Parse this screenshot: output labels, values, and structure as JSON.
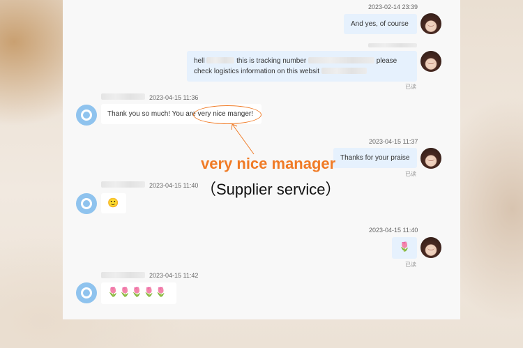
{
  "messages": [
    {
      "time": "2023-02-14 23:39",
      "text": "And yes, of course"
    },
    {
      "text_a": "hell",
      "text_b": "this is tracking number",
      "text_c": "please",
      "text_d": "check logistics information on this websit",
      "read": "已读"
    },
    {
      "time": "2023-04-15 11:36",
      "text_a": "Thank you so much! You are",
      "text_b": "very nice manger!"
    },
    {
      "time": "2023-04-15 11:37",
      "text": "Thanks for your praise",
      "read": "已读"
    },
    {
      "time": "2023-04-15 11:40",
      "emoji": "🙂"
    },
    {
      "time": "2023-04-15 11:40",
      "emoji": "🌷",
      "read": "已读"
    },
    {
      "time": "2023-04-15 11:42",
      "emoji": "🌷🌷🌷🌷🌷"
    }
  ],
  "annotation": {
    "title": "very nice manager",
    "subtitle": "（Supplier service）",
    "color": "#f07b26"
  },
  "colors": {
    "outgoing_bubble": "#e6f1fd",
    "incoming_bubble": "#ffffff",
    "accent": "#f07b26"
  }
}
